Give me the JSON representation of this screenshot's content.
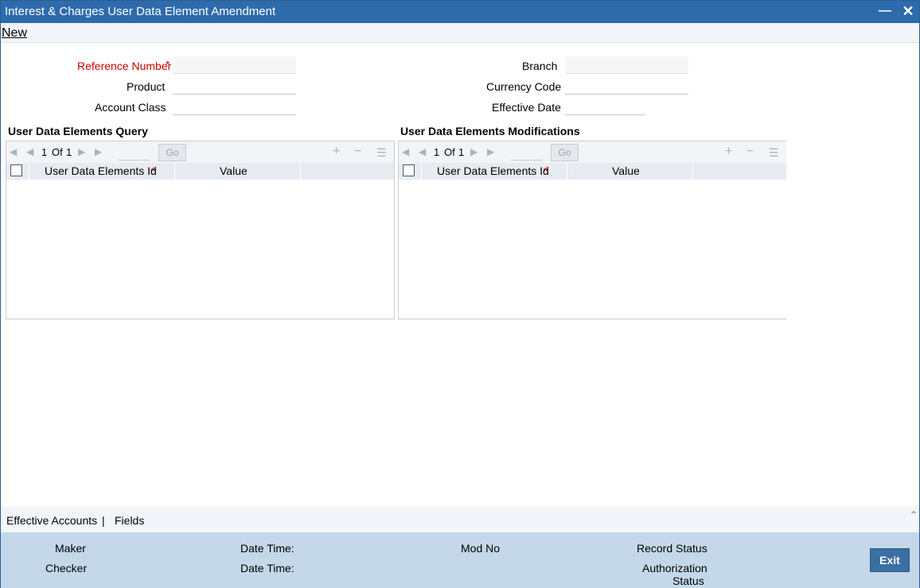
{
  "window": {
    "title": "Interest & Charges User Data Element Amendment"
  },
  "menu": {
    "new_label": "New"
  },
  "form": {
    "reference_number_label": "Reference Number",
    "product_label": "Product",
    "account_class_label": "Account Class",
    "branch_label": "Branch",
    "currency_code_label": "Currency Code",
    "effective_date_label": "Effective Date",
    "required_marker": "*"
  },
  "query_grid": {
    "title": "User Data Elements Query",
    "page_current": "1",
    "page_of": "Of",
    "page_total": "1",
    "go_label": "Go",
    "columns": [
      "User Data Elements Id",
      "Value"
    ]
  },
  "mod_grid": {
    "title": "User Data Elements Modifications",
    "page_current": "1",
    "page_of": "Of",
    "page_total": "1",
    "go_label": "Go",
    "columns": [
      "User Data Elements Id",
      "Value"
    ]
  },
  "bottom_tabs": {
    "effective_accounts": "Effective Accounts",
    "separator": "|",
    "fields": "Fields"
  },
  "audit": {
    "maker": "Maker",
    "checker": "Checker",
    "date_time_1": "Date Time:",
    "date_time_2": "Date Time:",
    "mod_no": "Mod No",
    "record_status": "Record Status",
    "authorization": "Authorization",
    "status": "Status",
    "exit_label": "Exit"
  },
  "icons": {
    "first": "first-page-icon",
    "prev": "prev-page-icon",
    "next": "next-page-icon",
    "last": "last-page-icon",
    "add": "add-row-icon",
    "delete": "delete-row-icon",
    "view": "single-view-icon"
  },
  "colors": {
    "titlebar": "#2e6bac",
    "audit_bg": "#c4d8ea",
    "exit_btn": "#3a6fa3",
    "required": "#cc0000"
  }
}
